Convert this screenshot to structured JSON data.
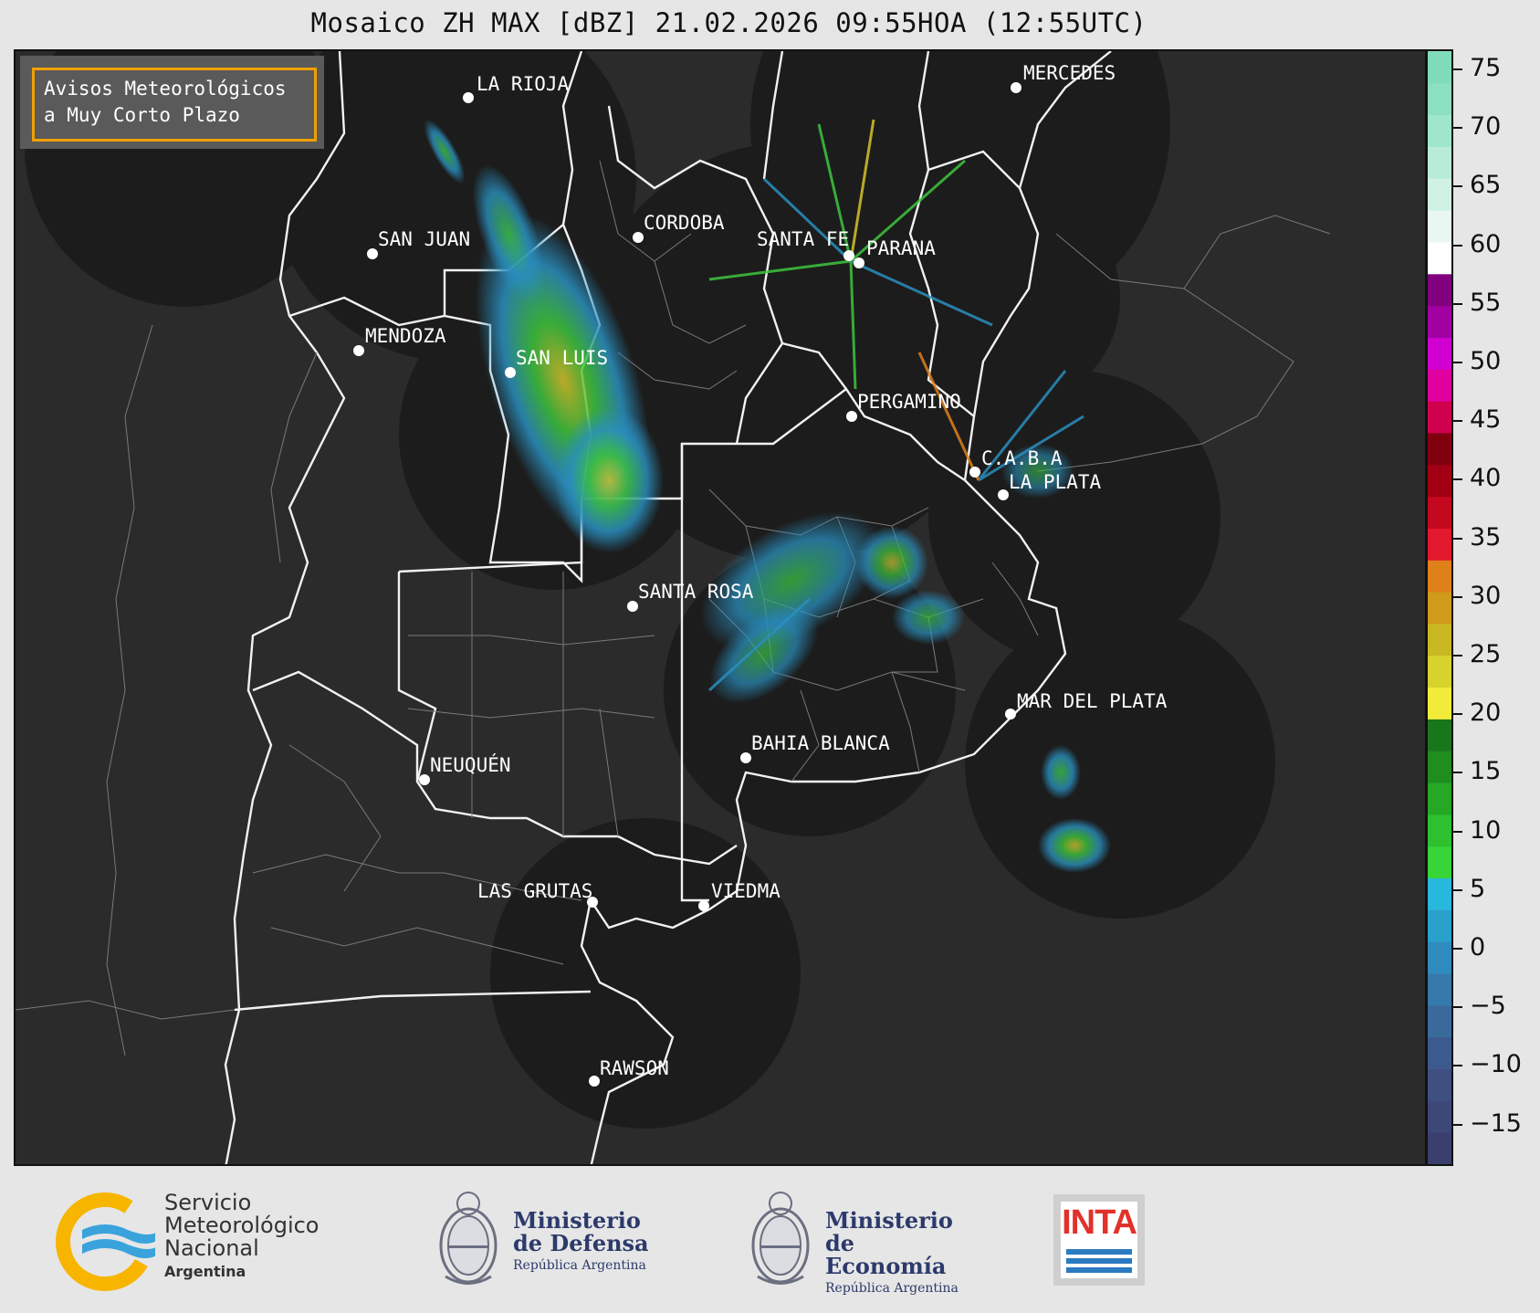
{
  "title": "Mosaico ZH MAX [dBZ] 21.02.2026 09:55HOA (12:55UTC)",
  "info_box": {
    "line1": "Avisos Meteorológicos",
    "line2": "a Muy Corto Plazo",
    "border_color": "#f0a000"
  },
  "cities": [
    {
      "name": "LA RIOJA"
    },
    {
      "name": "MERCEDES"
    },
    {
      "name": "CORDOBA"
    },
    {
      "name": "SAN JUAN"
    },
    {
      "name": "SANTA FE"
    },
    {
      "name": "PARANA"
    },
    {
      "name": "MENDOZA"
    },
    {
      "name": "SAN LUIS"
    },
    {
      "name": "PERGAMINO"
    },
    {
      "name": "C.A.B.A"
    },
    {
      "name": "LA PLATA"
    },
    {
      "name": "SANTA ROSA"
    },
    {
      "name": "MAR DEL PLATA"
    },
    {
      "name": "BAHIA BLANCA"
    },
    {
      "name": "NEUQUÉN"
    },
    {
      "name": "LAS GRUTAS"
    },
    {
      "name": "VIEDMA"
    },
    {
      "name": "RAWSON"
    }
  ],
  "colorbar": {
    "ticks": [
      "75",
      "70",
      "65",
      "60",
      "55",
      "50",
      "45",
      "40",
      "35",
      "30",
      "25",
      "20",
      "15",
      "10",
      "5",
      "0",
      "−5",
      "−10",
      "−15"
    ],
    "colors": [
      "#3a3f6e",
      "#3d4778",
      "#3f4f82",
      "#3d5a8e",
      "#3a6a9c",
      "#3679ab",
      "#2f8bbd",
      "#2aa0cc",
      "#28b7dd",
      "#38d438",
      "#2ec02e",
      "#26a726",
      "#1f8e1f",
      "#1a761a",
      "#f1ec3a",
      "#d8d22c",
      "#c9b823",
      "#d09a1a",
      "#e0801a",
      "#e2182e",
      "#c4081e",
      "#a10014",
      "#800010",
      "#d0004e",
      "#e000a0",
      "#d000d0",
      "#a000a0",
      "#800080",
      "#ffffff",
      "#e8f8f0",
      "#d0f2e4",
      "#b8ecd8",
      "#a0e6cc",
      "#8cdfc0",
      "#80dbb8"
    ]
  },
  "logos": {
    "smn": {
      "line1": "Servicio",
      "line2": "Meteorológico",
      "line3": "Nacional",
      "line4": "Argentina"
    },
    "defensa": {
      "line1": "Ministerio",
      "line2": "de Defensa",
      "line3": "República Argentina"
    },
    "economia": {
      "line1": "Ministerio",
      "line2": "de Economía",
      "line3": "República Argentina"
    },
    "inta": {
      "text": "INTA"
    }
  }
}
